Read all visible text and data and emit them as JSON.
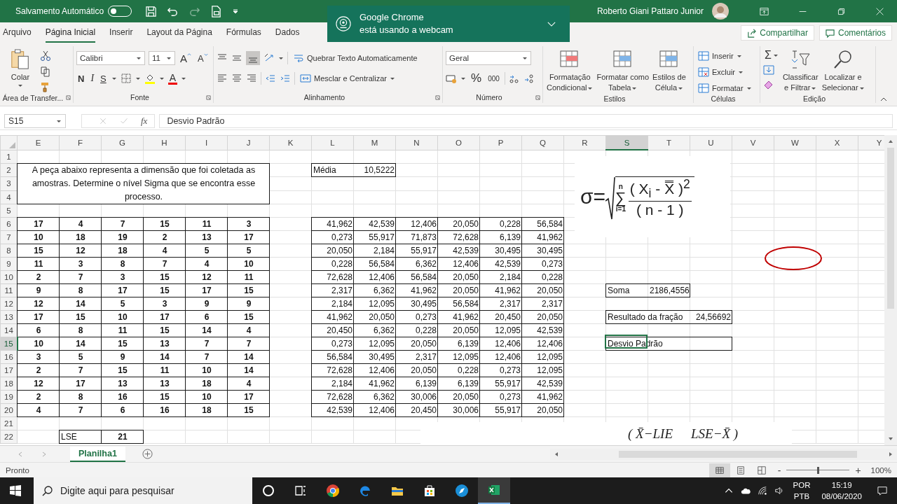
{
  "titlebar": {
    "autosave_label": "Salvamento Automático",
    "autosave_on": false,
    "user": "Roberto Giani Pattaro Junior"
  },
  "notification": {
    "title": "Google Chrome",
    "message": "está usando a webcam"
  },
  "tabs": [
    {
      "label": "Arquivo",
      "selected": false
    },
    {
      "label": "Página Inicial",
      "selected": true
    },
    {
      "label": "Inserir",
      "selected": false
    },
    {
      "label": "Layout da Página",
      "selected": false
    },
    {
      "label": "Fórmulas",
      "selected": false
    },
    {
      "label": "Dados",
      "selected": false
    }
  ],
  "share_button": "Compartilhar",
  "comments_button": "Comentários",
  "ribbon": {
    "clipboard": {
      "paste": "Colar",
      "group": "Área de Transfer..."
    },
    "font": {
      "name": "Calibri",
      "size": "11",
      "grow": "A",
      "shrink": "A",
      "bold": "N",
      "italic": "I",
      "underline": "S",
      "font_color_letter": "A",
      "group": "Fonte"
    },
    "alignment": {
      "wrap": "Quebrar Texto Automaticamente",
      "merge": "Mesclar e Centralizar",
      "group": "Alinhamento"
    },
    "number": {
      "format": "Geral",
      "percent": "%",
      "thousands": "000",
      "group": "Número"
    },
    "styles": {
      "buttons": [
        [
          "Formatação",
          "Condicional"
        ],
        [
          "Formatar como",
          "Tabela"
        ],
        [
          "Estilos de",
          "Célula"
        ]
      ],
      "group": "Estilos"
    },
    "cells": {
      "buttons": [
        "Inserir",
        "Excluir",
        "Formatar"
      ],
      "group": "Células"
    },
    "editing": {
      "sum": "Σ",
      "buttons": [
        [
          "Classificar",
          "e Filtrar"
        ],
        [
          "Localizar e",
          "Selecionar"
        ]
      ],
      "group": "Edição"
    }
  },
  "formula_bar": {
    "name_box": "S15",
    "fx": "fx",
    "content": "Desvio Padrão"
  },
  "sheet": {
    "columns": [
      {
        "label": "E",
        "selected": false
      },
      {
        "label": "F",
        "selected": false
      },
      {
        "label": "G",
        "selected": false
      },
      {
        "label": "H",
        "selected": false
      },
      {
        "label": "I",
        "selected": false
      },
      {
        "label": "J",
        "selected": false
      },
      {
        "label": "K",
        "selected": false
      },
      {
        "label": "L",
        "selected": false
      },
      {
        "label": "M",
        "selected": false
      },
      {
        "label": "N",
        "selected": false
      },
      {
        "label": "O",
        "selected": false
      },
      {
        "label": "P",
        "selected": false
      },
      {
        "label": "Q",
        "selected": false
      },
      {
        "label": "R",
        "selected": false
      },
      {
        "label": "S",
        "selected": true
      },
      {
        "label": "T",
        "selected": false
      },
      {
        "label": "U",
        "selected": false
      },
      {
        "label": "V",
        "selected": false
      },
      {
        "label": "W",
        "selected": false
      },
      {
        "label": "X",
        "selected": false
      },
      {
        "label": "Y",
        "selected": false
      }
    ],
    "rows": [
      {
        "label": "1",
        "selected": false
      },
      {
        "label": "2",
        "selected": false
      },
      {
        "label": "3",
        "selected": false
      },
      {
        "label": "4",
        "selected": false
      },
      {
        "label": "5",
        "selected": false
      },
      {
        "label": "6",
        "selected": false
      },
      {
        "label": "7",
        "selected": false
      },
      {
        "label": "8",
        "selected": false
      },
      {
        "label": "9",
        "selected": false
      },
      {
        "label": "10",
        "selected": false
      },
      {
        "label": "11",
        "selected": false
      },
      {
        "label": "12",
        "selected": false
      },
      {
        "label": "13",
        "selected": false
      },
      {
        "label": "14",
        "selected": false
      },
      {
        "label": "15",
        "selected": true
      },
      {
        "label": "16",
        "selected": false
      },
      {
        "label": "17",
        "selected": false
      },
      {
        "label": "18",
        "selected": false
      },
      {
        "label": "19",
        "selected": false
      },
      {
        "label": "20",
        "selected": false
      },
      {
        "label": "21",
        "selected": false
      },
      {
        "label": "22",
        "selected": false
      }
    ]
  },
  "intro": "A peça abaixo representa a dimensão que foi coletada as amostras. Determine o nível Sigma que se encontra esse processo.",
  "samples": [
    [
      "17",
      "4",
      "7",
      "15",
      "11",
      "3"
    ],
    [
      "10",
      "18",
      "19",
      "2",
      "13",
      "17"
    ],
    [
      "15",
      "12",
      "18",
      "4",
      "5",
      "5"
    ],
    [
      "11",
      "3",
      "8",
      "7",
      "4",
      "10"
    ],
    [
      "2",
      "7",
      "3",
      "15",
      "12",
      "11"
    ],
    [
      "9",
      "8",
      "17",
      "15",
      "17",
      "15"
    ],
    [
      "12",
      "14",
      "5",
      "3",
      "9",
      "9"
    ],
    [
      "17",
      "15",
      "10",
      "17",
      "6",
      "15"
    ],
    [
      "6",
      "8",
      "11",
      "15",
      "14",
      "4"
    ],
    [
      "10",
      "14",
      "15",
      "13",
      "7",
      "7"
    ],
    [
      "3",
      "5",
      "9",
      "14",
      "7",
      "14"
    ],
    [
      "2",
      "7",
      "15",
      "11",
      "10",
      "14"
    ],
    [
      "12",
      "17",
      "13",
      "13",
      "18",
      "4"
    ],
    [
      "2",
      "8",
      "16",
      "15",
      "10",
      "17"
    ],
    [
      "4",
      "7",
      "6",
      "16",
      "18",
      "15"
    ]
  ],
  "mean": {
    "label": "Média",
    "value": "10,5222"
  },
  "squares": [
    [
      "41,962",
      "42,539",
      "12,406",
      "20,050",
      "0,228",
      "56,584"
    ],
    [
      "0,273",
      "55,917",
      "71,873",
      "72,628",
      "6,139",
      "41,962"
    ],
    [
      "20,050",
      "2,184",
      "55,917",
      "42,539",
      "30,495",
      "30,495"
    ],
    [
      "0,228",
      "56,584",
      "6,362",
      "12,406",
      "42,539",
      "0,273"
    ],
    [
      "72,628",
      "12,406",
      "56,584",
      "20,050",
      "2,184",
      "0,228"
    ],
    [
      "2,317",
      "6,362",
      "41,962",
      "20,050",
      "41,962",
      "20,050"
    ],
    [
      "2,184",
      "12,095",
      "30,495",
      "56,584",
      "2,317",
      "2,317"
    ],
    [
      "41,962",
      "20,050",
      "0,273",
      "41,962",
      "20,450",
      "20,050"
    ],
    [
      "20,450",
      "6,362",
      "0,228",
      "20,050",
      "12,095",
      "42,539"
    ],
    [
      "0,273",
      "12,095",
      "20,050",
      "6,139",
      "12,406",
      "12,406"
    ],
    [
      "56,584",
      "30,495",
      "2,317",
      "12,095",
      "12,406",
      "12,095"
    ],
    [
      "72,628",
      "12,406",
      "20,050",
      "0,228",
      "0,273",
      "12,095"
    ],
    [
      "2,184",
      "41,962",
      "6,139",
      "6,139",
      "55,917",
      "42,539"
    ],
    [
      "72,628",
      "6,362",
      "30,006",
      "20,050",
      "0,273",
      "41,962"
    ],
    [
      "42,539",
      "12,406",
      "20,450",
      "30,006",
      "55,917",
      "20,050"
    ]
  ],
  "sum": {
    "label": "Soma",
    "value": "2186,4556"
  },
  "fraction": {
    "label": "Resultado da fração",
    "value": "24,56692"
  },
  "std_dev": {
    "label": "Desvio Padrão"
  },
  "lse": {
    "label": "LSE",
    "value": "21"
  },
  "formula": {
    "lhs": "σ=",
    "sum_top": "n",
    "sigma": "∑",
    "sum_bottom": "i=1",
    "numerator": "( X$_{i}$ - X̿ )$^{2}$",
    "denominator": "( n - 1 )"
  },
  "formula2": [
    "( X̄−LIE",
    "LSE−X̄ )"
  ],
  "sheet_tabs": [
    {
      "label": "Planilha1",
      "selected": true
    }
  ],
  "status": {
    "text": "Pronto",
    "zoom_out": "-",
    "zoom_in": "+",
    "level": 0.5,
    "zoom": "100%"
  },
  "taskbar": {
    "search_placeholder": "Digite aqui para pesquisar",
    "lang": "POR",
    "layout": "PTB",
    "time": "15:19",
    "date": "08/06/2020"
  }
}
